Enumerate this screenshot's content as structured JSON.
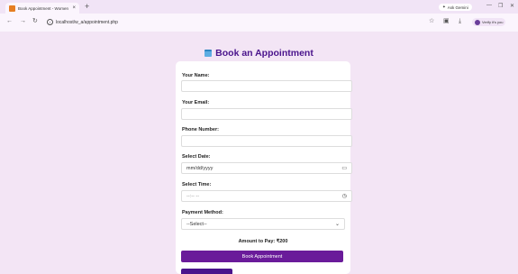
{
  "browser": {
    "tab_title": "Book Appointment - Women I",
    "tab_close": "×",
    "new_tab": "+",
    "ask_gemini": "Ask Gemini",
    "url": "localhost/w_a/appointment.php",
    "verify_label": "Verify it's you",
    "minimize": "—",
    "restore": "❐",
    "close": "✕"
  },
  "page": {
    "title": "Book an Appointment"
  },
  "form": {
    "name_label": "Your Name:",
    "name_value": "",
    "email_label": "Your Email:",
    "email_value": "",
    "phone_label": "Phone Number:",
    "phone_value": "",
    "date_label": "Select Date:",
    "date_placeholder": "mm/dd/yyyy",
    "time_label": "Select Time:",
    "time_placeholder": "--:-- --",
    "payment_label": "Payment Method:",
    "payment_selected": "--Select--",
    "amount_text": "Amount to Pay: ₹200",
    "submit_label": "Book Appointment"
  },
  "colors": {
    "page_bg": "#f3e5f5",
    "accent": "#6a1b9a",
    "title": "#4a148c"
  },
  "icons": [
    "calendar-icon",
    "back-icon",
    "forward-icon",
    "reload-icon",
    "star-icon",
    "download-icon",
    "clock-icon",
    "chevron-down-icon"
  ]
}
